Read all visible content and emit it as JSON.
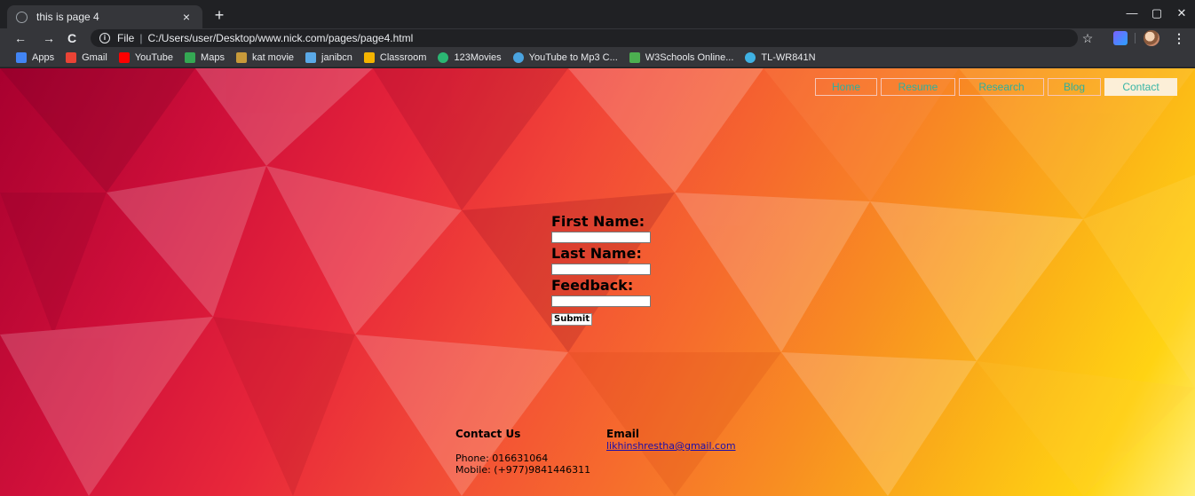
{
  "browser": {
    "tab_title": "this is page 4",
    "tab_close": "×",
    "new_tab": "+",
    "window_controls": {
      "minimize": "—",
      "maximize": "▢",
      "close": "✕"
    },
    "nav": {
      "back": "←",
      "forward": "→",
      "reload": "C"
    },
    "address": {
      "scheme_label": "File",
      "separator": "|",
      "url": "C:/Users/user/Desktop/www.nick.com/pages/page4.html"
    },
    "star": "☆",
    "menu": "⋮",
    "bookmarks": [
      {
        "label": "Apps",
        "icon": "apps-grid-icon",
        "color": "#4285f4"
      },
      {
        "label": "Gmail",
        "icon": "gmail-icon",
        "color": "#ea4335"
      },
      {
        "label": "YouTube",
        "icon": "youtube-icon",
        "color": "#ff0000"
      },
      {
        "label": "Maps",
        "icon": "maps-icon",
        "color": "#34a853"
      },
      {
        "label": "kat movie",
        "icon": "kat-movie-icon",
        "color": "#c89a3a"
      },
      {
        "label": "janibcn",
        "icon": "janibcn-icon",
        "color": "#5aa9e6"
      },
      {
        "label": "Classroom",
        "icon": "classroom-icon",
        "color": "#f4b400"
      },
      {
        "label": "123Movies",
        "icon": "123movies-icon",
        "color": "#2bb673"
      },
      {
        "label": "YouTube to Mp3 C...",
        "icon": "cloud-icon",
        "color": "#4aa3df"
      },
      {
        "label": "W3Schools Online...",
        "icon": "w3schools-icon",
        "color": "#4caf50"
      },
      {
        "label": "TL-WR841N",
        "icon": "tplink-icon",
        "color": "#3fb1e3"
      }
    ]
  },
  "page": {
    "nav": [
      {
        "label": "Home",
        "active": false
      },
      {
        "label": "Resume",
        "active": false
      },
      {
        "label": "Research",
        "active": false
      },
      {
        "label": "Blog",
        "active": false
      },
      {
        "label": "Contact",
        "active": true
      }
    ],
    "form": {
      "first_name_label": "First Name:",
      "first_name_value": "",
      "last_name_label": "Last Name:",
      "last_name_value": "",
      "feedback_label": "Feedback:",
      "feedback_value": "",
      "submit_label": "Submit"
    },
    "footer": {
      "contact_heading": "Contact Us",
      "phone": "Phone: 016631064",
      "mobile": "Mobile: (+977)9841446311",
      "email_heading": "Email",
      "email": "likhinshrestha@gmail.com"
    }
  },
  "colors": {
    "accent_text": "#2db09f",
    "gradient_start": "#a8002f",
    "gradient_end": "#fff07a"
  }
}
